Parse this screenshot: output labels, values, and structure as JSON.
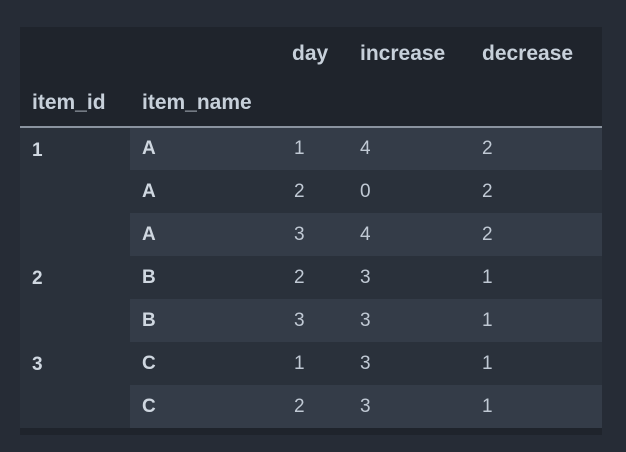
{
  "columns": {
    "top": [
      "day",
      "increase",
      "decrease"
    ],
    "index": [
      "item_id",
      "item_name"
    ]
  },
  "groups": [
    {
      "item_id": "1",
      "rows": [
        {
          "item_name": "A",
          "day": "1",
          "increase": "4",
          "decrease": "2"
        },
        {
          "item_name": "A",
          "day": "2",
          "increase": "0",
          "decrease": "2"
        },
        {
          "item_name": "A",
          "day": "3",
          "increase": "4",
          "decrease": "2"
        }
      ]
    },
    {
      "item_id": "2",
      "rows": [
        {
          "item_name": "B",
          "day": "2",
          "increase": "3",
          "decrease": "1"
        },
        {
          "item_name": "B",
          "day": "3",
          "increase": "3",
          "decrease": "1"
        }
      ]
    },
    {
      "item_id": "3",
      "rows": [
        {
          "item_name": "C",
          "day": "1",
          "increase": "3",
          "decrease": "1"
        },
        {
          "item_name": "C",
          "day": "2",
          "increase": "3",
          "decrease": "1"
        }
      ]
    }
  ],
  "colors": {
    "page_background": "#262c36",
    "table_background": "#1f242c",
    "row_light": "#343c48",
    "row_dark": "#2a313b",
    "text": "#c2ccd8",
    "header_rule": "#8a939f"
  }
}
